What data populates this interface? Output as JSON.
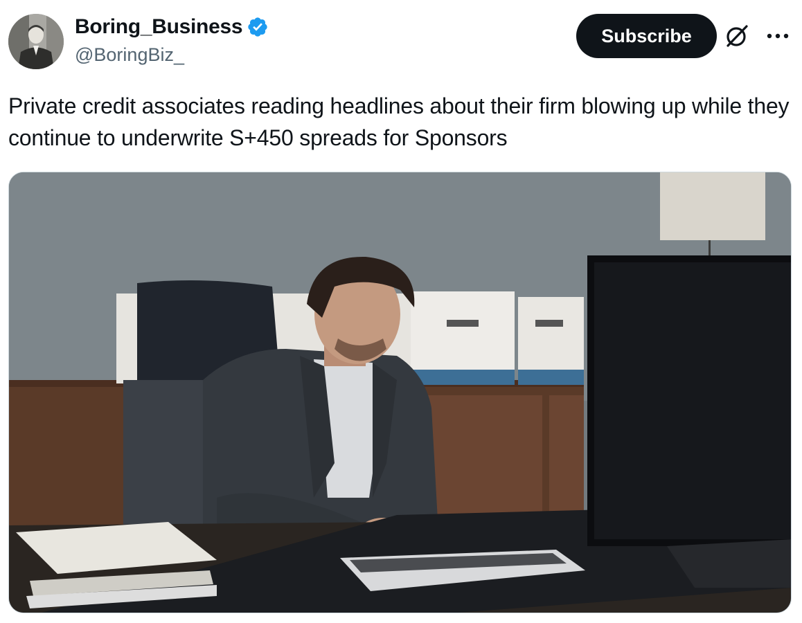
{
  "author": {
    "display_name": "Boring_Business",
    "handle": "@BoringBiz_",
    "verified": true,
    "avatar_icon": "avatar-portrait"
  },
  "actions": {
    "subscribe_label": "Subscribe",
    "grok_icon": "grok-icon",
    "more_icon": "more-options-icon"
  },
  "tweet": {
    "text": "Private credit associates reading headlines about their firm blowing up while they continue to underwrite S+450 spreads for Sponsors"
  },
  "colors": {
    "text_primary": "#0f1419",
    "text_secondary": "#536471",
    "verified_blue": "#1d9bf0",
    "button_bg": "#0f1419"
  }
}
